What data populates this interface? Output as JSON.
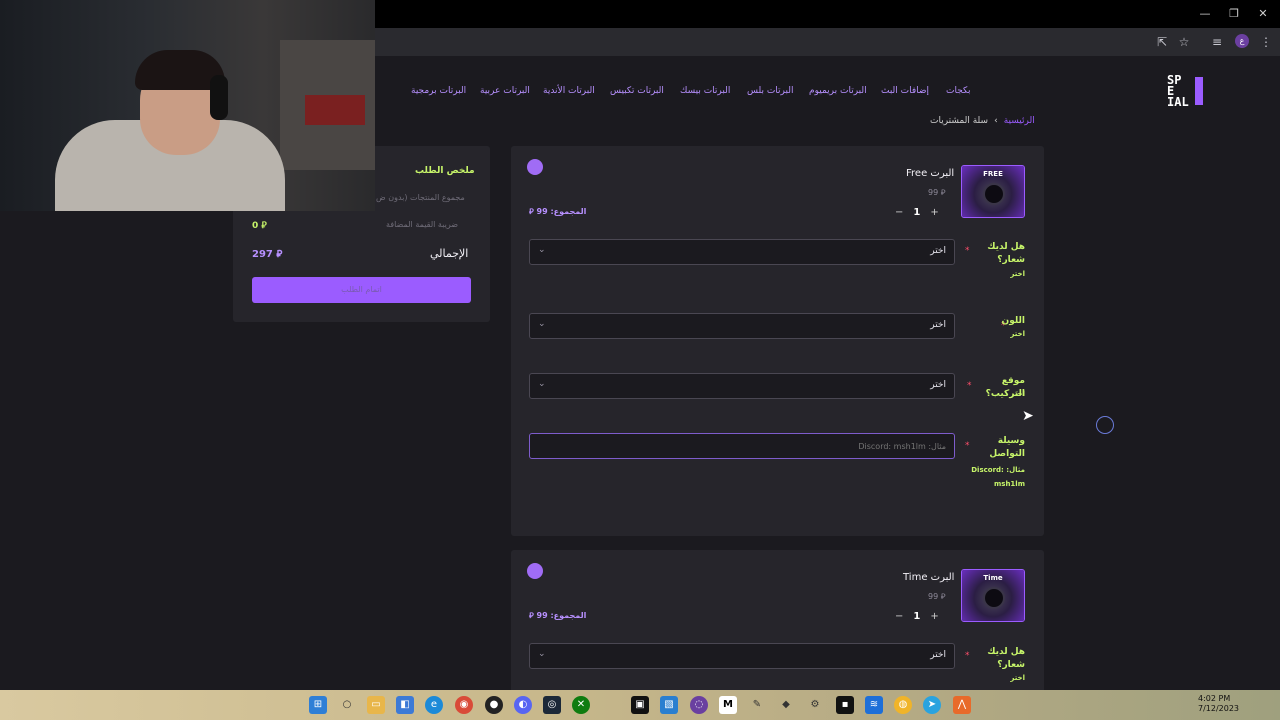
{
  "window": {
    "minimize": "—",
    "restore": "❐",
    "close": "✕"
  },
  "toolbar": {
    "install_icon": "⇱",
    "star_icon": "☆",
    "media_icon": "≡",
    "profile_letter": "ع",
    "menu_icon": "⋮"
  },
  "nav": [
    "بكجات",
    "إضافات البث",
    "البرتات بريميوم",
    "البرتات بلس",
    "البرتات بيسك",
    "البرتات تكبيس",
    "البرتات الأندية",
    "البرتات عربية",
    "البرتات برمجية"
  ],
  "logo": {
    "text": "SP\nE\nIAL"
  },
  "breadcrumb": {
    "home": "الرئيسية",
    "sep": "›",
    "current": "سلة المشتريات"
  },
  "summary": {
    "title": "ملخص الطلب",
    "subtotal_label": "مجموع المنتجات (بدون ض",
    "vat_label": "ضريبة القيمة المضافة",
    "vat_value": "0 ⃁",
    "total_label": "الإجمالي",
    "total_value": "297 ⃁",
    "checkout_label": "اتمام الطلب"
  },
  "cards": [
    {
      "thumb_tag": "FREE",
      "name": "البرت Free",
      "price": "99 ⃁",
      "qty_minus": "−",
      "qty": "1",
      "qty_plus": "+",
      "subtotal": "المجموع: 99 ⃁",
      "fields": [
        {
          "label": "هل لديك شعار؟",
          "hint": "اختر",
          "value": "اختر"
        },
        {
          "label": "اللون",
          "hint": "اختر",
          "value": "اختر"
        },
        {
          "label": "موقع التركيب؟",
          "hint": "اختر",
          "value": "اختر"
        }
      ],
      "contact": {
        "label": "وسيلة التواصل",
        "hint": "مثال: Discord: msh1lm",
        "placeholder": "مثال: Discord: msh1lm"
      }
    },
    {
      "thumb_tag": "Time",
      "name": "البرت Time",
      "price": "99 ⃁",
      "qty_minus": "−",
      "qty": "1",
      "qty_plus": "+",
      "subtotal": "المجموع: 99 ⃁",
      "fields": [
        {
          "label": "هل لديك شعار؟",
          "hint": "اختر",
          "value": "اختر"
        }
      ]
    }
  ],
  "required_mark": "*",
  "chevron": "⌄",
  "cursor": "➤",
  "taskbar": {
    "start_icon": "⊞",
    "search_icon": "○",
    "files_icon": "▭",
    "store_icon": "◧",
    "edge_icon": "e",
    "chrome_icon": "◉",
    "github_icon": "●",
    "discord_icon": "◐",
    "steam_icon": "◎",
    "xbox_icon": "✕",
    "capcut_icon": "▣",
    "vscode_icon": "▧",
    "obs_icon": "◌",
    "notion_icon": "M",
    "tools_icon": "✎",
    "app1_icon": "◆",
    "settings_icon": "⚙",
    "terminal_icon": "▪",
    "app2_icon": "≋",
    "app3_icon": "◍",
    "telegram_icon": "➤",
    "app4_icon": "⋀",
    "chrome_badge": "2",
    "github_badge": "3",
    "xbox_badge": "4",
    "clock_time": "4:02 PM",
    "clock_date": "7/12/2023"
  }
}
